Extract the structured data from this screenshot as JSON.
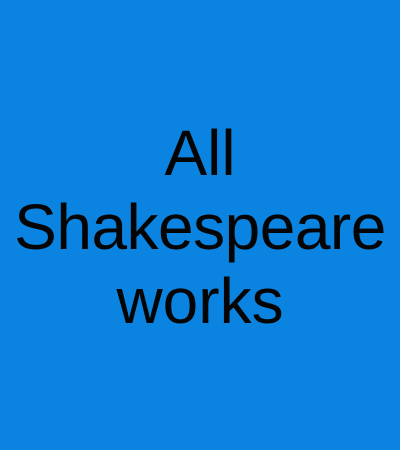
{
  "tile": {
    "title_lines": [
      "All",
      "Shakespeare",
      "works"
    ],
    "background_color": "#0a84e0",
    "text_color": "#050505"
  }
}
